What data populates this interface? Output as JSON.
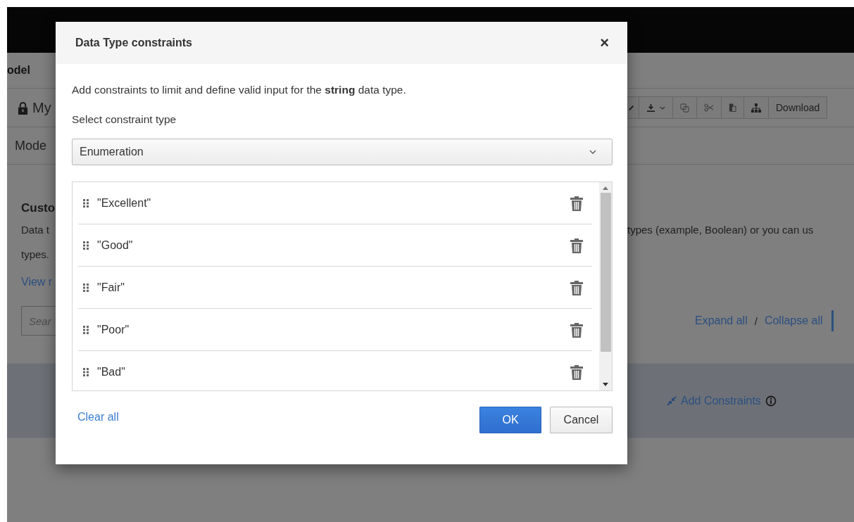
{
  "background": {
    "top_label": "odel",
    "title": "My",
    "tab": "Mode",
    "heading": "Custo",
    "description_left": "Data t",
    "description_right": "types (example, Boolean) or you can us",
    "description_left_2": "types.",
    "link": "View r",
    "search": {
      "placeholder": "Sear"
    },
    "toolbar": {
      "button": "Download"
    },
    "expand_all": "Expand all",
    "separator": "/",
    "collapse_all": "Collapse all",
    "add_constraints": "Add Constraints"
  },
  "dialog": {
    "title": "Data Type constraints",
    "close": "×",
    "description": "Add constraints to limit and define valid input for the **string** data type.",
    "select_label": "Select constraint type",
    "select": {
      "value": "Enumeration"
    },
    "values": [
      "\"Excellent\"",
      "\"Good\"",
      "\"Fair\"",
      "\"Poor\"",
      "\"Bad\""
    ],
    "clear_all": "Clear all",
    "buttons": [
      {
        "label": "OK",
        "kind": "primary"
      },
      {
        "label": "Cancel",
        "kind": "secondary"
      }
    ]
  }
}
